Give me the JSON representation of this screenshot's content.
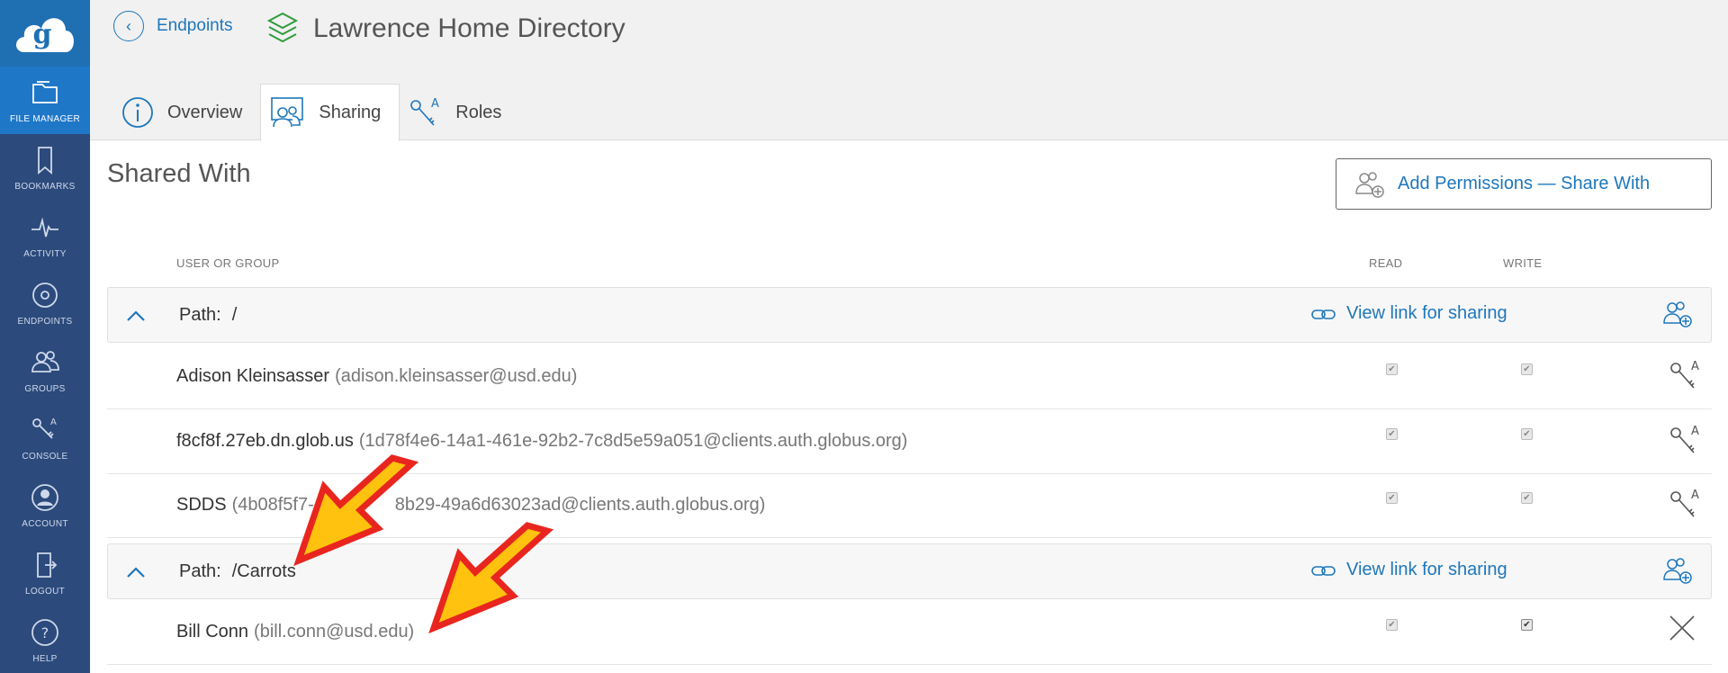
{
  "sidebar": {
    "items": [
      {
        "label": "FILE MANAGER",
        "icon": "folder-icon",
        "active": true
      },
      {
        "label": "BOOKMARKS",
        "icon": "bookmark-icon",
        "active": false
      },
      {
        "label": "ACTIVITY",
        "icon": "activity-icon",
        "active": false
      },
      {
        "label": "ENDPOINTS",
        "icon": "endpoint-icon",
        "active": false
      },
      {
        "label": "GROUPS",
        "icon": "groups-icon",
        "active": false
      },
      {
        "label": "CONSOLE",
        "icon": "console-icon",
        "active": false
      },
      {
        "label": "ACCOUNT",
        "icon": "account-icon",
        "active": false
      },
      {
        "label": "LOGOUT",
        "icon": "logout-icon",
        "active": false
      },
      {
        "label": "HELP",
        "icon": "help-icon",
        "active": false
      }
    ]
  },
  "header": {
    "back_label": "Endpoints",
    "title": "Lawrence Home Directory",
    "tabs": [
      {
        "label": "Overview",
        "icon": "info-icon"
      },
      {
        "label": "Sharing",
        "icon": "sharing-icon"
      },
      {
        "label": "Roles",
        "icon": "roles-icon"
      }
    ]
  },
  "main": {
    "section_title": "Shared With",
    "add_button_label": "Add Permissions — Share With",
    "columns": {
      "user_or_group": "USER OR GROUP",
      "read": "READ",
      "write": "WRITE"
    },
    "path_prefix": "Path:",
    "view_link_label": "View link for sharing",
    "groups": [
      {
        "path": "/",
        "users": [
          {
            "name": "Adison Kleinsasser",
            "email": "(adison.kleinsasser@usd.edu)",
            "read": true,
            "write": true,
            "action": "roles-icon"
          },
          {
            "name": "f8cf8f.27eb.dn.glob.us",
            "email": "(1d78f4e6-14a1-461e-92b2-7c8d5e59a051@clients.auth.globus.org)",
            "read": true,
            "write": true,
            "action": "roles-icon"
          },
          {
            "name": "SDDS",
            "email": "(4b08f5f7-",
            "email_tail": "8b29-49a6d63023ad@clients.auth.globus.org)",
            "read": true,
            "write": true,
            "action": "roles-icon"
          }
        ]
      },
      {
        "path": "/Carrots",
        "users": [
          {
            "name": "Bill Conn",
            "email": "(bill.conn@usd.edu)",
            "read": true,
            "write": true,
            "action": "close-icon"
          }
        ]
      }
    ]
  },
  "colors": {
    "sidebar_bg": "#2c4a7c",
    "sidebar_active": "#1f77c8",
    "accent": "#1e77bb",
    "arrow_fill": "#ffc20e",
    "arrow_stroke": "#e8261f"
  }
}
